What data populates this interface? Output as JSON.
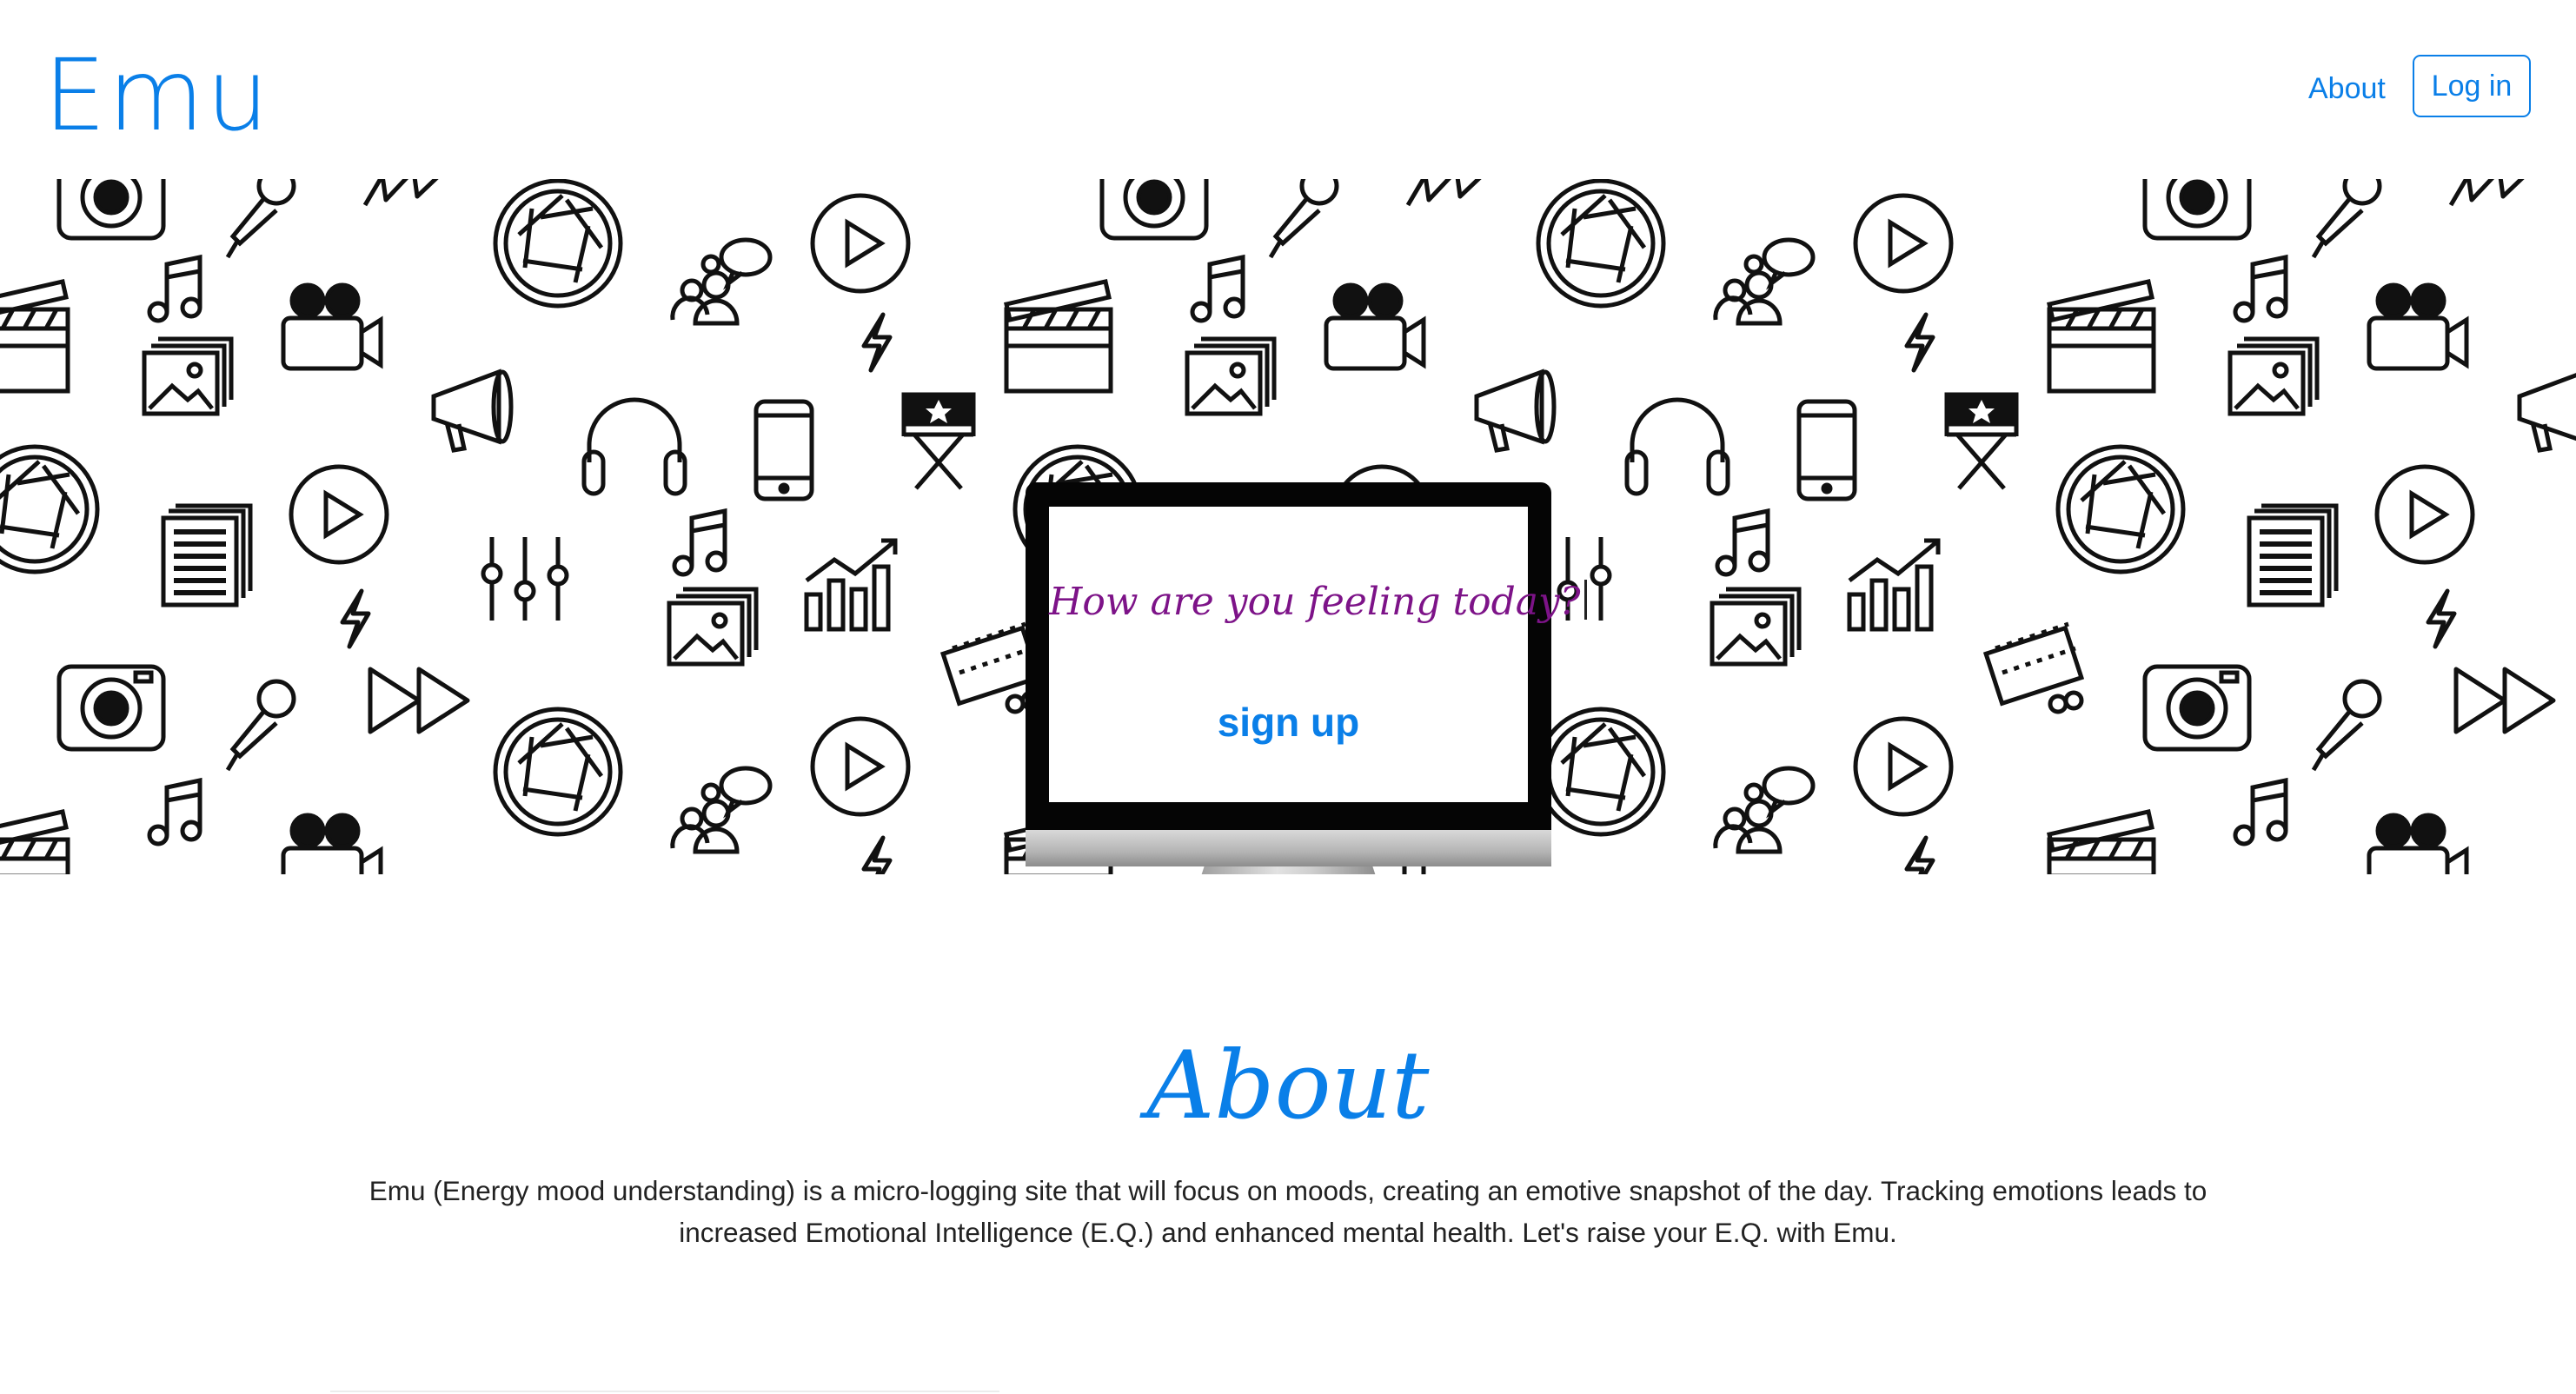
{
  "navbar": {
    "brand": "Emu",
    "about_link": "About",
    "login_button": "Log in",
    "accent_color": "#0a7fe8"
  },
  "hero": {
    "prompt": "How are you feeling today?",
    "prompt_color": "#7d1388",
    "signup_link": "sign up",
    "background_icons": [
      "camera-icon",
      "microphone-icon",
      "lightning-icon",
      "aperture-icon",
      "play-icon",
      "group-chat-icon",
      "clapperboard-icon",
      "music-note-icon",
      "movie-camera-icon",
      "photo-gallery-icon",
      "megaphone-icon",
      "headphones-icon",
      "smartphone-icon",
      "director-chair-icon",
      "document-icon",
      "equalizer-icon",
      "growth-chart-icon",
      "film-strip-icon",
      "fast-forward-icon"
    ]
  },
  "about": {
    "heading": "About",
    "body": "Emu (Energy mood understanding) is a micro-logging site that will focus on moods, creating an emotive snapshot of the day. Tracking emotions leads to increased Emotional Intelligence (E.Q.) and enhanced mental health. Let's raise your E.Q. with Emu."
  }
}
